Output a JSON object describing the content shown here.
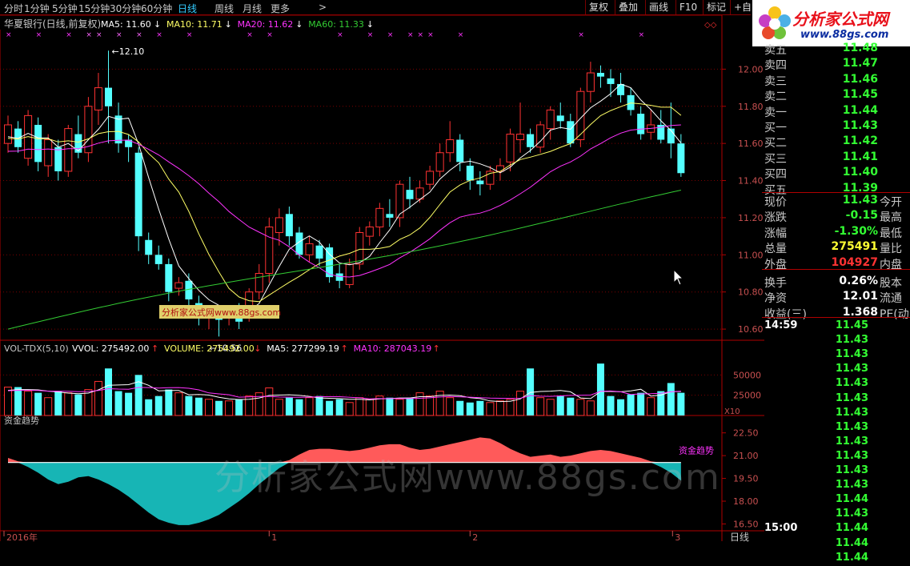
{
  "toolbar": {
    "periods": [
      "分时",
      "1分钟",
      "5分钟",
      "15分钟",
      "30分钟",
      "60分钟",
      "日线",
      "周线",
      "月线",
      "更多"
    ],
    "active": "日线",
    "more_arrow": ">",
    "right_tabs": [
      "复权",
      "叠加",
      "画线",
      "F10",
      "标记",
      "+自"
    ]
  },
  "logo": {
    "name": "分析家公式网",
    "url": "www.88gs.com"
  },
  "main_chart": {
    "stock_title": "华夏银行(日线,前复权)",
    "ma_labels": [
      {
        "text": "MA5: 11.60",
        "arrow": "↓",
        "color": "#ffffff"
      },
      {
        "text": "MA10: 11.71",
        "arrow": "↓",
        "color": "#ffff66"
      },
      {
        "text": "MA20: 11.62",
        "arrow": "↓",
        "color": "#ff33ff"
      },
      {
        "text": "MA60: 11.33",
        "arrow": "↓",
        "color": "#33cc33"
      }
    ],
    "high_mark": "12.10",
    "low_mark": "10.56",
    "y_ticks": [
      "12.00",
      "11.80",
      "11.60",
      "11.40",
      "11.20",
      "11.00",
      "10.80",
      "10.60"
    ],
    "y_range": [
      10.54,
      12.2
    ],
    "watermark_box": "分析家公式网www.88gs.com"
  },
  "volume_chart": {
    "title": "VOL-TDX(5,10)",
    "labels": [
      {
        "text": "VVOL: 275492.00",
        "arrow": "↑",
        "color": "#ffffff"
      },
      {
        "text": "VOLUME: 275492.00",
        "arrow": "↓",
        "color": "#ffff66"
      },
      {
        "text": "MA5: 277299.19",
        "arrow": "↑",
        "color": "#ffffff"
      },
      {
        "text": "MA10: 287043.19",
        "arrow": "↑",
        "color": "#ff33ff"
      }
    ],
    "y_ticks": [
      "50000",
      "25000"
    ],
    "unit": "X10"
  },
  "fund_chart": {
    "title": "资金趋势",
    "legend": "资金趋势",
    "y_ticks": [
      "22.50",
      "21.00",
      "19.50",
      "18.00",
      "16.50"
    ]
  },
  "x_axis": {
    "labels": [
      "2016年",
      "1",
      "2",
      "3"
    ],
    "period": "日线"
  },
  "big_watermark": "分析家公式网www.88gs.com",
  "chart_data": {
    "type": "candlestick",
    "candles": [
      {
        "o": 11.6,
        "h": 11.75,
        "l": 11.55,
        "c": 11.7
      },
      {
        "o": 11.68,
        "h": 11.72,
        "l": 11.55,
        "c": 11.58
      },
      {
        "o": 11.52,
        "h": 11.78,
        "l": 11.48,
        "c": 11.75
      },
      {
        "o": 11.7,
        "h": 11.74,
        "l": 11.45,
        "c": 11.5
      },
      {
        "o": 11.48,
        "h": 11.65,
        "l": 11.42,
        "c": 11.62
      },
      {
        "o": 11.58,
        "h": 11.62,
        "l": 11.4,
        "c": 11.45
      },
      {
        "o": 11.45,
        "h": 11.7,
        "l": 11.42,
        "c": 11.68
      },
      {
        "o": 11.65,
        "h": 11.75,
        "l": 11.52,
        "c": 11.55
      },
      {
        "o": 11.55,
        "h": 11.85,
        "l": 11.5,
        "c": 11.8
      },
      {
        "o": 11.78,
        "h": 11.98,
        "l": 11.7,
        "c": 11.9
      },
      {
        "o": 11.9,
        "h": 12.1,
        "l": 11.6,
        "c": 11.8
      },
      {
        "o": 11.75,
        "h": 11.82,
        "l": 11.55,
        "c": 11.6
      },
      {
        "o": 11.62,
        "h": 11.65,
        "l": 11.5,
        "c": 11.58
      },
      {
        "o": 11.55,
        "h": 11.58,
        "l": 11.02,
        "c": 11.1
      },
      {
        "o": 11.08,
        "h": 11.12,
        "l": 10.95,
        "c": 11.0
      },
      {
        "o": 11.0,
        "h": 11.05,
        "l": 10.92,
        "c": 10.95
      },
      {
        "o": 10.95,
        "h": 10.98,
        "l": 10.75,
        "c": 10.8
      },
      {
        "o": 10.82,
        "h": 10.88,
        "l": 10.78,
        "c": 10.85
      },
      {
        "o": 10.86,
        "h": 10.9,
        "l": 10.72,
        "c": 10.76
      },
      {
        "o": 10.74,
        "h": 10.78,
        "l": 10.62,
        "c": 10.68
      },
      {
        "o": 10.66,
        "h": 10.72,
        "l": 10.6,
        "c": 10.7
      },
      {
        "o": 10.68,
        "h": 10.7,
        "l": 10.56,
        "c": 10.65
      },
      {
        "o": 10.66,
        "h": 10.72,
        "l": 10.62,
        "c": 10.7
      },
      {
        "o": 10.7,
        "h": 10.74,
        "l": 10.6,
        "c": 10.64
      },
      {
        "o": 10.66,
        "h": 10.82,
        "l": 10.64,
        "c": 10.8
      },
      {
        "o": 10.8,
        "h": 10.95,
        "l": 10.76,
        "c": 10.9
      },
      {
        "o": 10.9,
        "h": 11.2,
        "l": 10.85,
        "c": 11.15
      },
      {
        "o": 11.12,
        "h": 11.25,
        "l": 11.05,
        "c": 11.2
      },
      {
        "o": 11.22,
        "h": 11.26,
        "l": 11.05,
        "c": 11.1
      },
      {
        "o": 11.12,
        "h": 11.15,
        "l": 10.98,
        "c": 11.0
      },
      {
        "o": 11.0,
        "h": 11.1,
        "l": 10.96,
        "c": 11.06
      },
      {
        "o": 11.05,
        "h": 11.08,
        "l": 10.94,
        "c": 10.98
      },
      {
        "o": 11.04,
        "h": 11.06,
        "l": 10.85,
        "c": 10.88
      },
      {
        "o": 10.9,
        "h": 10.95,
        "l": 10.82,
        "c": 10.86
      },
      {
        "o": 10.84,
        "h": 10.98,
        "l": 10.82,
        "c": 10.95
      },
      {
        "o": 10.95,
        "h": 11.15,
        "l": 10.92,
        "c": 11.12
      },
      {
        "o": 11.1,
        "h": 11.18,
        "l": 11.05,
        "c": 11.15
      },
      {
        "o": 11.15,
        "h": 11.28,
        "l": 11.1,
        "c": 11.25
      },
      {
        "o": 11.22,
        "h": 11.3,
        "l": 11.15,
        "c": 11.2
      },
      {
        "o": 11.2,
        "h": 11.4,
        "l": 11.15,
        "c": 11.38
      },
      {
        "o": 11.35,
        "h": 11.42,
        "l": 11.25,
        "c": 11.3
      },
      {
        "o": 11.3,
        "h": 11.4,
        "l": 11.28,
        "c": 11.36
      },
      {
        "o": 11.38,
        "h": 11.48,
        "l": 11.35,
        "c": 11.45
      },
      {
        "o": 11.45,
        "h": 11.6,
        "l": 11.42,
        "c": 11.55
      },
      {
        "o": 11.55,
        "h": 11.72,
        "l": 11.5,
        "c": 11.62
      },
      {
        "o": 11.62,
        "h": 11.65,
        "l": 11.45,
        "c": 11.5
      },
      {
        "o": 11.48,
        "h": 11.52,
        "l": 11.35,
        "c": 11.4
      },
      {
        "o": 11.4,
        "h": 11.45,
        "l": 11.32,
        "c": 11.38
      },
      {
        "o": 11.38,
        "h": 11.48,
        "l": 11.35,
        "c": 11.45
      },
      {
        "o": 11.45,
        "h": 11.52,
        "l": 11.4,
        "c": 11.48
      },
      {
        "o": 11.5,
        "h": 11.68,
        "l": 11.45,
        "c": 11.65
      },
      {
        "o": 11.62,
        "h": 11.82,
        "l": 11.55,
        "c": 11.65
      },
      {
        "o": 11.65,
        "h": 11.68,
        "l": 11.55,
        "c": 11.58
      },
      {
        "o": 11.58,
        "h": 11.72,
        "l": 11.55,
        "c": 11.7
      },
      {
        "o": 11.68,
        "h": 11.8,
        "l": 11.62,
        "c": 11.78
      },
      {
        "o": 11.75,
        "h": 11.82,
        "l": 11.68,
        "c": 11.72
      },
      {
        "o": 11.72,
        "h": 11.76,
        "l": 11.58,
        "c": 11.6
      },
      {
        "o": 11.62,
        "h": 11.9,
        "l": 11.58,
        "c": 11.88
      },
      {
        "o": 11.88,
        "h": 12.04,
        "l": 11.82,
        "c": 11.98
      },
      {
        "o": 11.98,
        "h": 12.02,
        "l": 11.9,
        "c": 11.96
      },
      {
        "o": 11.95,
        "h": 12.0,
        "l": 11.85,
        "c": 11.92
      },
      {
        "o": 11.92,
        "h": 11.98,
        "l": 11.82,
        "c": 11.86
      },
      {
        "o": 11.86,
        "h": 11.9,
        "l": 11.75,
        "c": 11.78
      },
      {
        "o": 11.76,
        "h": 11.8,
        "l": 11.62,
        "c": 11.65
      },
      {
        "o": 11.66,
        "h": 11.78,
        "l": 11.62,
        "c": 11.7
      },
      {
        "o": 11.7,
        "h": 11.78,
        "l": 11.6,
        "c": 11.62
      },
      {
        "o": 11.68,
        "h": 11.82,
        "l": 11.52,
        "c": 11.6
      },
      {
        "o": 11.6,
        "h": 11.65,
        "l": 11.42,
        "c": 11.44
      }
    ],
    "volume": [
      35,
      35,
      30,
      28,
      22,
      30,
      28,
      26,
      32,
      42,
      58,
      30,
      28,
      50,
      20,
      24,
      32,
      28,
      24,
      22,
      20,
      18,
      18,
      20,
      24,
      28,
      34,
      20,
      22,
      20,
      22,
      24,
      18,
      20,
      16,
      22,
      20,
      24,
      22,
      20,
      22,
      28,
      24,
      30,
      22,
      18,
      16,
      18,
      16,
      18,
      20,
      30,
      58,
      22,
      20,
      24,
      22,
      20,
      18,
      64,
      24,
      20,
      26,
      28,
      22,
      30,
      40,
      28
    ],
    "vol_ylim": [
      0,
      75
    ],
    "fund_trend": [
      0.4,
      0.1,
      -0.4,
      -0.9,
      -1.5,
      -1.9,
      -1.7,
      -1.3,
      -1.2,
      -1.5,
      -1.9,
      -2.4,
      -3.0,
      -3.7,
      -4.4,
      -5.0,
      -5.3,
      -5.5,
      -5.5,
      -5.3,
      -5.0,
      -4.6,
      -4.0,
      -3.4,
      -2.7,
      -1.9,
      -1.2,
      -0.5,
      0.2,
      0.7,
      1.1,
      1.2,
      1.2,
      1.1,
      1.0,
      1.1,
      1.3,
      1.5,
      1.6,
      1.6,
      1.3,
      1.1,
      1.2,
      1.4,
      1.6,
      1.8,
      2.0,
      2.2,
      2.1,
      1.7,
      1.2,
      0.8,
      0.5,
      0.6,
      0.7,
      0.5,
      0.6,
      0.8,
      1.0,
      1.1,
      1.0,
      0.8,
      0.6,
      0.4,
      0.1,
      -0.4,
      -0.9,
      -1.6
    ],
    "fund_ylim": [
      -6,
      3
    ]
  },
  "quote_panel": {
    "order_book": [
      {
        "label": "卖五",
        "price": "11.48"
      },
      {
        "label": "卖四",
        "price": "11.47"
      },
      {
        "label": "卖三",
        "price": "11.46"
      },
      {
        "label": "卖二",
        "price": "11.45"
      },
      {
        "label": "卖一",
        "price": "11.44"
      },
      {
        "label": "买一",
        "price": "11.43"
      },
      {
        "label": "买二",
        "price": "11.42"
      },
      {
        "label": "买三",
        "price": "11.41"
      },
      {
        "label": "买四",
        "price": "11.40"
      },
      {
        "label": "买五",
        "price": "11.39"
      }
    ],
    "stats": [
      {
        "label": "现价",
        "value": "11.43",
        "label2": "今开",
        "color": "#33ff33"
      },
      {
        "label": "涨跌",
        "value": "-0.15",
        "label2": "最高",
        "color": "#33ff33"
      },
      {
        "label": "涨幅",
        "value": "-1.30%",
        "label2": "最低",
        "color": "#33ff33"
      },
      {
        "label": "总量",
        "value": "275491",
        "label2": "量比",
        "color": "#ffff33"
      },
      {
        "label": "外盘",
        "value": "104927",
        "label2": "内盘",
        "color": "#ff3333"
      },
      {
        "label": "换手",
        "value": "0.26%",
        "label2": "股本",
        "color": "#ffffff"
      },
      {
        "label": "净资",
        "value": "12.01",
        "label2": "流通",
        "color": "#ffffff"
      },
      {
        "label": "收益(三)",
        "value": "1.368",
        "label2": "PE(动)",
        "color": "#ffffff"
      }
    ],
    "ticks": [
      {
        "time": "14:59",
        "price": "11.45"
      },
      {
        "time": "",
        "price": "11.43"
      },
      {
        "time": "",
        "price": "11.43"
      },
      {
        "time": "",
        "price": "11.43"
      },
      {
        "time": "",
        "price": "11.43"
      },
      {
        "time": "",
        "price": "11.43"
      },
      {
        "time": "",
        "price": "11.43"
      },
      {
        "time": "",
        "price": "11.43"
      },
      {
        "time": "",
        "price": "11.43"
      },
      {
        "time": "",
        "price": "11.43"
      },
      {
        "time": "",
        "price": "11.43"
      },
      {
        "time": "",
        "price": "11.43"
      },
      {
        "time": "",
        "price": "11.44"
      },
      {
        "time": "",
        "price": "11.43"
      },
      {
        "time": "15:00",
        "price": "11.44"
      },
      {
        "time": "",
        "price": "11.44"
      },
      {
        "time": "",
        "price": "11.44"
      }
    ]
  }
}
